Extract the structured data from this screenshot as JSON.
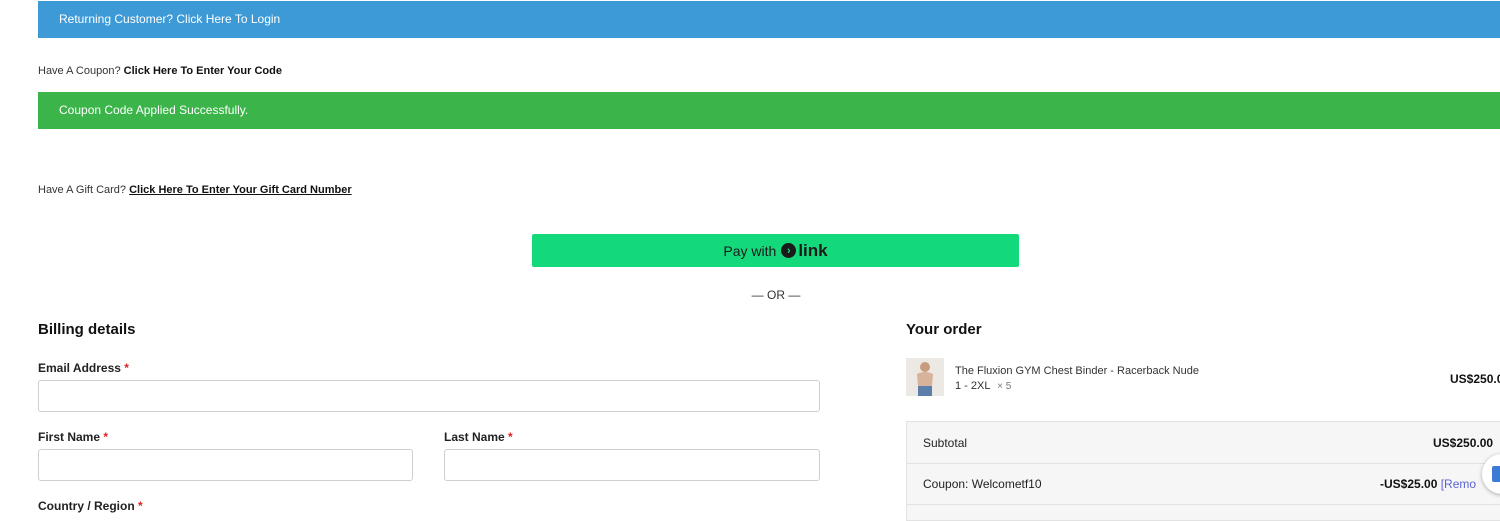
{
  "notices": {
    "login": "Returning Customer? Click Here To Login",
    "coupon_applied": "Coupon Code Applied Successfully."
  },
  "coupon_prompt": {
    "text": "Have A Coupon?",
    "link": "Click Here To Enter Your Code"
  },
  "giftcard_prompt": {
    "text": "Have A Gift Card?",
    "link": "Click Here To Enter Your Gift Card Number"
  },
  "pay_button": {
    "prefix": "Pay with",
    "brand": "link"
  },
  "or_divider": "— OR —",
  "billing": {
    "title": "Billing details",
    "email_label": "Email Address",
    "first_name_label": "First Name",
    "last_name_label": "Last Name",
    "country_label": "Country / Region",
    "required_mark": "*"
  },
  "order": {
    "title": "Your order",
    "item": {
      "name": "The Fluxion GYM Chest Binder - Racerback Nude",
      "variant": "1 - 2XL",
      "qty": "× 5",
      "price": "US$250.0"
    },
    "subtotal_label": "Subtotal",
    "subtotal_value": "US$250.00",
    "coupon_label": "Coupon: Welcometf10",
    "coupon_value": "-US$25.00",
    "remove_label": "[Remo"
  },
  "colors": {
    "notice_blue": "#3d9ad6",
    "notice_green": "#3bb54a",
    "link_green": "#14d97b"
  }
}
